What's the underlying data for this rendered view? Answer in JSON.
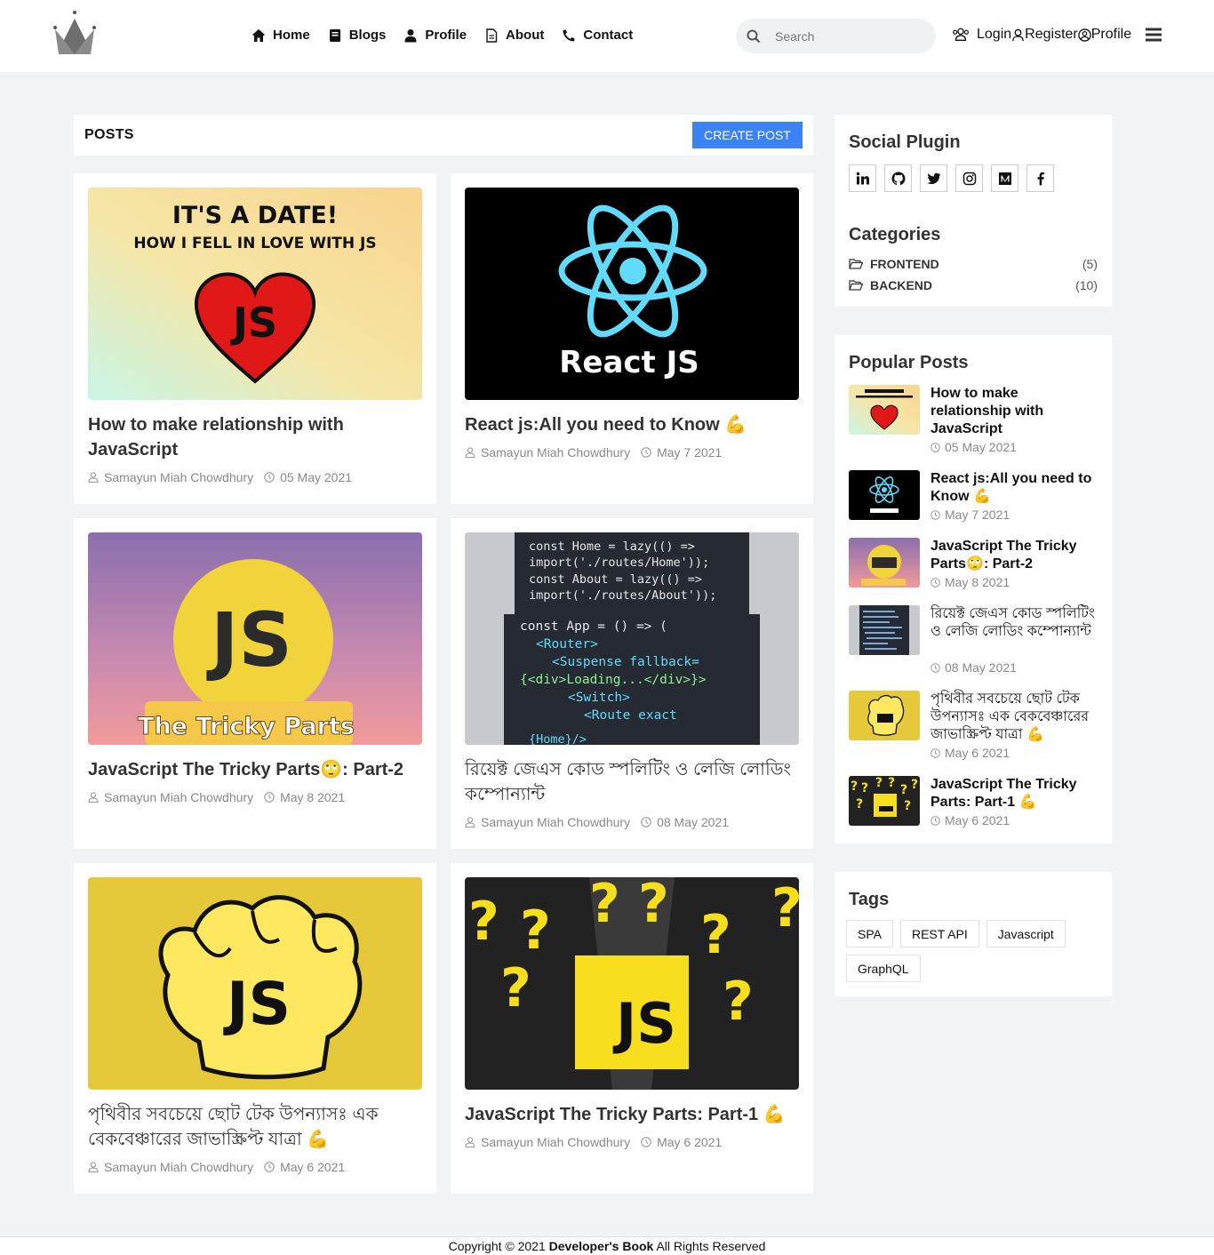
{
  "nav": {
    "menu": [
      {
        "label": "Home",
        "icon": "home-icon"
      },
      {
        "label": "Blogs",
        "icon": "book-icon"
      },
      {
        "label": "Profile",
        "icon": "user-icon"
      },
      {
        "label": "About",
        "icon": "file-icon"
      },
      {
        "label": "Contact",
        "icon": "phone-icon"
      }
    ],
    "search_placeholder": "Search",
    "login": "Login",
    "register": "Register",
    "profile": "Profile"
  },
  "posts": {
    "heading": "POSTS",
    "create_label": "CREATE POST",
    "items": [
      {
        "title": "How to make relationship with JavaScript",
        "author": "Samayun Miah Chowdhury",
        "date": "05 May 2021",
        "thumb_text": [
          "IT'S A DATE!",
          "HOW I FELL IN LOVE WITH JS",
          "JS"
        ]
      },
      {
        "title": "React js:All you need to Know 💪",
        "author": "Samayun Miah Chowdhury",
        "date": "May 7 2021",
        "thumb_text": [
          "React JS"
        ]
      },
      {
        "title": "JavaScript The Tricky Parts🙄: Part-2",
        "author": "Samayun Miah Chowdhury",
        "date": "May 8 2021",
        "thumb_text": [
          "JS",
          "The Tricky Parts"
        ]
      },
      {
        "title": "রিয়েক্ট জেএস কোড স্পলিটিং ও লেজি লোডিং কম্পোন্যান্ট",
        "author": "Samayun Miah Chowdhury",
        "date": "08 May 2021",
        "thumb_text": []
      },
      {
        "title": "পৃথিবীর সবচেয়ে ছোট টেক উপন্যাসঃ এক বেকবেঞ্চারের জাভাস্ক্রিপ্ট যাত্রা 💪",
        "author": "Samayun Miah Chowdhury",
        "date": "May 6 2021",
        "thumb_text": [
          "JS"
        ]
      },
      {
        "title": "JavaScript The Tricky Parts: Part-1 💪",
        "author": "Samayun Miah Chowdhury",
        "date": "May 6 2021",
        "thumb_text": [
          "JS"
        ]
      }
    ]
  },
  "sidebar": {
    "social_title": "Social Plugin",
    "social_icons": [
      "linkedin-icon",
      "github-icon",
      "twitter-icon",
      "instagram-icon",
      "medium-icon",
      "facebook-icon"
    ],
    "categories_title": "Categories",
    "categories": [
      {
        "name": "FRONTEND",
        "count": "(5)"
      },
      {
        "name": "BACKEND",
        "count": "(10)"
      }
    ],
    "popular_title": "Popular Posts",
    "popular": [
      {
        "title": "How to make relationship with JavaScript",
        "date": "05 May 2021"
      },
      {
        "title": "React js:All you need to Know 💪",
        "date": "May 7 2021"
      },
      {
        "title": "JavaScript The Tricky Parts🙄: Part-2",
        "date": "May 8 2021"
      },
      {
        "title": "রিয়েক্ট জেএস কোড স্পলিটিং ও লেজি লোডিং কম্পোন্যান্ট",
        "date": "08 May 2021"
      },
      {
        "title": "পৃথিবীর সবচেয়ে ছোট টেক উপন্যাসঃ এক বেকবেঞ্চারের জাভাস্ক্রিপ্ট যাত্রা 💪",
        "date": "May 6 2021"
      },
      {
        "title": "JavaScript The Tricky Parts: Part-1 💪",
        "date": "May 6 2021"
      }
    ],
    "tags_title": "Tags",
    "tags": [
      "SPA",
      "REST API",
      "Javascript",
      "GraphQL"
    ]
  },
  "footer": {
    "prefix": "Copyright © 2021 ",
    "brand": "Developer's Book",
    "suffix": " All Rights Reserved"
  },
  "code_lines": [
    "const Home = lazy(() =>",
    "import('./routes/Home'));",
    "const About = lazy(() =>",
    "import('./routes/About'));",
    "const App = () => (",
    "<Router>",
    "<Suspense fallback=",
    "{<div>Loading...</div>}>",
    "<Switch>",
    "<Route exact",
    "{Home}/>"
  ],
  "colors": {
    "accent": "#3b82f6",
    "react": "#61dafb",
    "js_yellow": "#f7df1e"
  }
}
